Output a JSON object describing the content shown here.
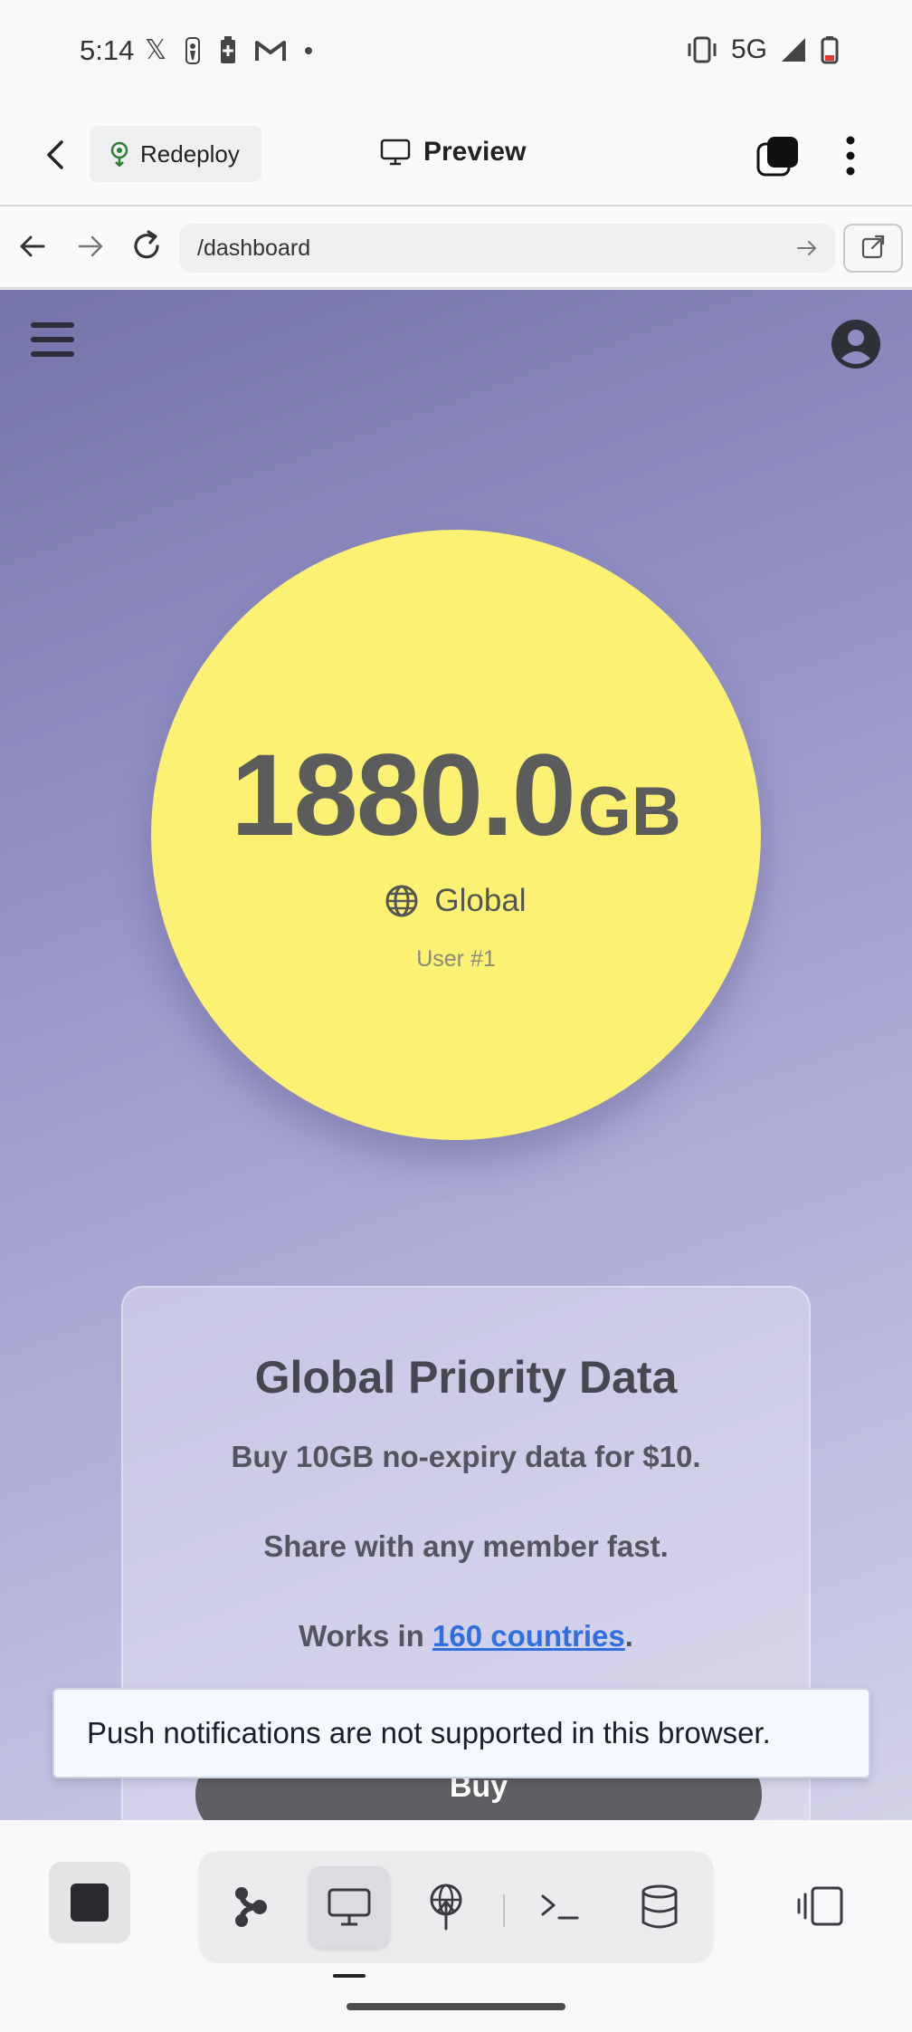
{
  "status_bar": {
    "time": "5:14",
    "network": "5G",
    "left_icons": [
      "x-icon",
      "nba-icon",
      "battery-saver-icon",
      "gmail-icon",
      "dot-icon"
    ],
    "right_icons": [
      "vibrate-icon",
      "signal-icon",
      "battery-low-icon"
    ]
  },
  "app_toolbar": {
    "redeploy_label": "Redeploy",
    "title": "Preview"
  },
  "browser": {
    "url": "/dashboard"
  },
  "page": {
    "data_amount": "1880.0",
    "data_unit": "GB",
    "region": "Global",
    "user_label": "User #1",
    "card": {
      "title": "Global Priority Data",
      "line1": "Buy 10GB no-expiry data for $10.",
      "line2": "Share with any member fast.",
      "line3_prefix": "Works in ",
      "line3_link": "160 countries",
      "line3_suffix": ".",
      "buy_label": "Buy"
    },
    "toast": "Push notifications are not supported in this browser."
  },
  "bottom_bar": {
    "tools": [
      "agent-icon",
      "preview-icon",
      "deploy-icon",
      "terminal-icon",
      "database-icon"
    ],
    "active_tool": "preview-icon"
  },
  "colors": {
    "circle": "#fdf173",
    "link": "#2f6fe0",
    "buy_button": "#5f5f63",
    "gradient_start": "#7574aa",
    "gradient_end": "#d3d2e8"
  }
}
